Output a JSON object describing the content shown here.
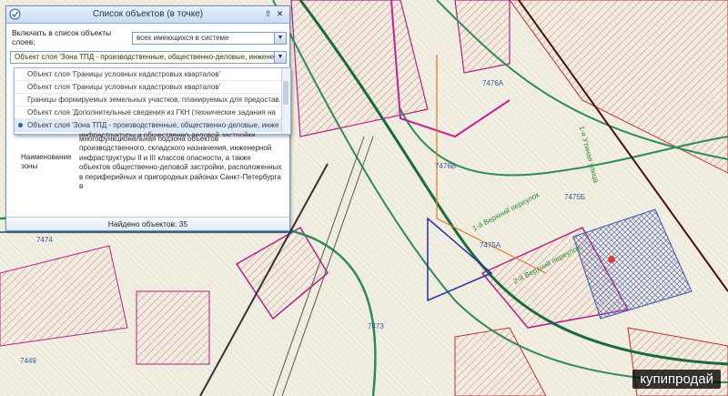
{
  "panel": {
    "title": "Список объектов (в точке)",
    "include_label": "Включать в список объекты слоев:",
    "layers_select": "всех имеющихся в системе",
    "object_select": "Объект слоя 'Зона ТПД - производственные, общественно-деловые, инженер",
    "dropdown_items": [
      "Объект слоя 'Границы условных кадастровых кварталов'",
      "Объект слоя 'Границы условных кадастровых кварталов'",
      "Границы формируемых земельных участков, планируемых для предостав.",
      "Объект слоя 'Дополнительные сведения из ГКН (технические задания на",
      "Объект слоя 'Зона ТПД - производственные, общественно-деловые, инже"
    ],
    "cut_text": "инфраструктуры и общественно-деловой застройки",
    "zone_label": "Наименование зоны",
    "zone_text": "многофункциональная подзона объектов производственного, складского назначения, инженерной инфраструктуры II и III классов опасности, а также объектов общественно-деловой застройки, расположенных в периферийных и пригородных районах Санкт-Петербурга в",
    "footer": "Найдено объектов: 35"
  },
  "map": {
    "labels": [
      "7476А",
      "7476Б",
      "7475Б",
      "7475А",
      "7473",
      "7474",
      "7449"
    ],
    "streets": [
      "1-й Верхний переулок",
      "2-й Верхний переулок",
      "1-я Утиная улица"
    ]
  },
  "watermark": "купипродай",
  "colors": {
    "accent": "#6f95c4",
    "hatch_red": "#d9534f",
    "hatch_purple": "#b2228c",
    "road_green": "#2e8b57"
  }
}
